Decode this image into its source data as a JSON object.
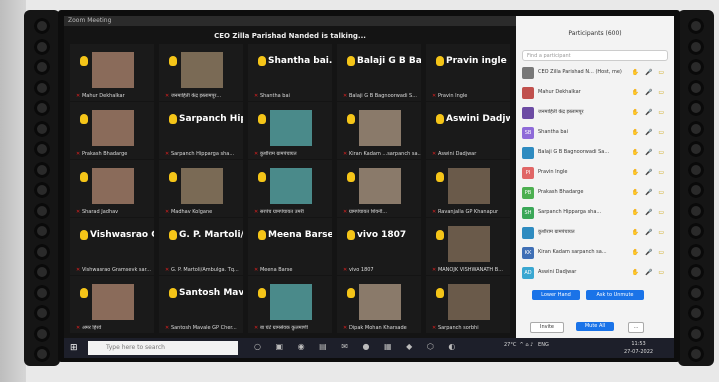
{
  "window_title": "Zoom Meeting",
  "talking_banner": "CEO Zilla Parishad Nanded is talking...",
  "tiles": [
    {
      "big": "",
      "name": "Mahur Dekhalkar"
    },
    {
      "big": "",
      "name": "जनमाहिती केंद्र इस्लामपूर..."
    },
    {
      "big": "Shantha bai...",
      "name": "Shantha bai"
    },
    {
      "big": "Balaji G B Bagn...",
      "name": "Balaji G B Bagnoorwadi S..."
    },
    {
      "big": "Pravin ingle",
      "name": "Pravin Ingle"
    },
    {
      "big": "",
      "name": "Prakash Bhadarge"
    },
    {
      "big": "Sarpanch Hippa...",
      "name": "Sarpanch Hipparga sha..."
    },
    {
      "big": "",
      "name": "कुशीराम ग्रामपंचायत"
    },
    {
      "big": "",
      "name": "Kiran Kadam ...sarpanch sa..."
    },
    {
      "big": "Aswini Dadjwar",
      "name": "Aswini Dadjwar"
    },
    {
      "big": "",
      "name": "Sharad Jadhav"
    },
    {
      "big": "",
      "name": "Madhav Kolgane"
    },
    {
      "big": "",
      "name": "सरपंच ग्रामपंचायत उमरी"
    },
    {
      "big": "",
      "name": "ग्रामपंचायत शिवनी..."
    },
    {
      "big": "",
      "name": "Ravanjalla GP Khanapur"
    },
    {
      "big": "Vishwasrao Gra...",
      "name": "Vishwasrao Gramsevk sar..."
    },
    {
      "big": "G. P. Martoli/A...",
      "name": "G. P. Martoli/Ambulga. Tq..."
    },
    {
      "big": "Meena Barse",
      "name": "Meena Barse"
    },
    {
      "big": "vivo 1807",
      "name": "vivo 1807"
    },
    {
      "big": "",
      "name": "MANOJK VISHWANATH B..."
    },
    {
      "big": "",
      "name": "अमर हिरवे"
    },
    {
      "big": "Santosh Mavale...",
      "name": "Santosh Mavale GP Cher..."
    },
    {
      "big": "",
      "name": "बा घंटे ग्रामसेवक कुलमाणी"
    },
    {
      "big": "",
      "name": "Dipak Mohan Kharsade"
    },
    {
      "big": "",
      "name": "Sarpanch sorbhi"
    }
  ],
  "panel": {
    "title": "Participants (600)",
    "search_placeholder": "Find a participant",
    "participants": [
      {
        "initials": "",
        "name": "CEO Zilla Parishad N...",
        "suffix": "(Host, me)",
        "color": "#777777"
      },
      {
        "initials": "",
        "name": "Mahur Dekhalkar",
        "suffix": "",
        "color": "#c0504d"
      },
      {
        "initials": "",
        "name": "जनमाहिती केंद्र इस्लामपूर",
        "suffix": "",
        "color": "#6c4ba3"
      },
      {
        "initials": "SB",
        "name": "Shantha bai",
        "suffix": "",
        "color": "#8e6ad8"
      },
      {
        "initials": "",
        "name": "Balaji G B Bagnoorwadi Sa...",
        "suffix": "",
        "color": "#2e8bc0"
      },
      {
        "initials": "PI",
        "name": "Pravin Ingle",
        "suffix": "",
        "color": "#e06666"
      },
      {
        "initials": "PB",
        "name": "Prakash Bhadarge",
        "suffix": "",
        "color": "#4caf50"
      },
      {
        "initials": "SH",
        "name": "Sarpanch Hipparga sha...",
        "suffix": "",
        "color": "#3aa757"
      },
      {
        "initials": "",
        "name": "कुशीराम ग्रामपंचायत",
        "suffix": "",
        "color": "#2e8bc0"
      },
      {
        "initials": "KK",
        "name": "Kiran Kadam sarpanch sa...",
        "suffix": "",
        "color": "#3f6fb5"
      },
      {
        "initials": "AD",
        "name": "Aswini Dadjwar",
        "suffix": "",
        "color": "#3aa7d1"
      }
    ],
    "lower_hand": "Lower Hand",
    "ask_unmute": "Ask to Unmute",
    "invite": "Invite",
    "mute_all": "Mute All",
    "more": "..."
  },
  "taskbar": {
    "search_placeholder": "Type here to search",
    "weather": "27°C",
    "lang": "ENG",
    "time": "11:53",
    "date": "27-07-2022"
  }
}
